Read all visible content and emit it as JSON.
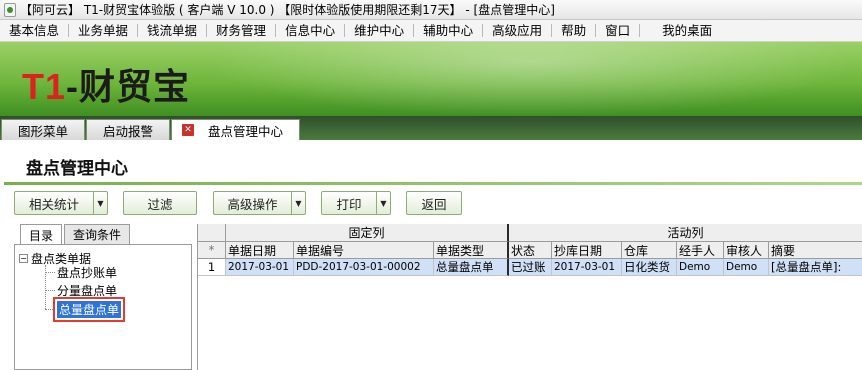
{
  "window": {
    "title": "【阿可云】 T1-财贸宝体验版 ( 客户端 V 10.0 ) 【限时体验版使用期限还剩17天】 - [盘点管理中心]"
  },
  "menu": {
    "items": [
      "基本信息",
      "业务单据",
      "钱流单据",
      "财务管理",
      "信息中心",
      "维护中心",
      "辅助中心",
      "高级应用",
      "帮助",
      "窗口",
      "我的桌面"
    ]
  },
  "banner": {
    "logo_t": "T1",
    "logo_rest": "-财贸宝",
    "colors": {
      "accent": "#6fb63c",
      "logo_red": "#d9231c"
    }
  },
  "tabs": [
    {
      "label": "图形菜单"
    },
    {
      "label": "启动报警"
    },
    {
      "label": "盘点管理中心",
      "active": true
    }
  ],
  "page": {
    "title": "盘点管理中心"
  },
  "toolbar": {
    "stats_label": "相关统计",
    "filter_label": "过滤",
    "advanced_label": "高级操作",
    "print_label": "打印",
    "back_label": "返回"
  },
  "left": {
    "tabs": [
      "目录",
      "查询条件"
    ],
    "tree": {
      "root": "盘点类单据",
      "children": [
        "盘点抄账单",
        "分量盘点单",
        "总量盘点单"
      ],
      "selected": "总量盘点单"
    }
  },
  "grid": {
    "groups": {
      "fixed": "固定列",
      "active": "活动列"
    },
    "row_marker": "*",
    "columns": [
      "单据日期",
      "单据编号",
      "单据类型",
      "状态",
      "抄库日期",
      "仓库",
      "经手人",
      "审核人",
      "摘要"
    ],
    "rows": [
      {
        "index": "1",
        "cells": [
          "2017-03-01",
          "PDD-2017-03-01-00002",
          "总量盘点单",
          "已过账",
          "2017-03-01",
          "日化类货",
          "Demo",
          "Demo",
          "[总量盘点单]:"
        ]
      }
    ]
  }
}
